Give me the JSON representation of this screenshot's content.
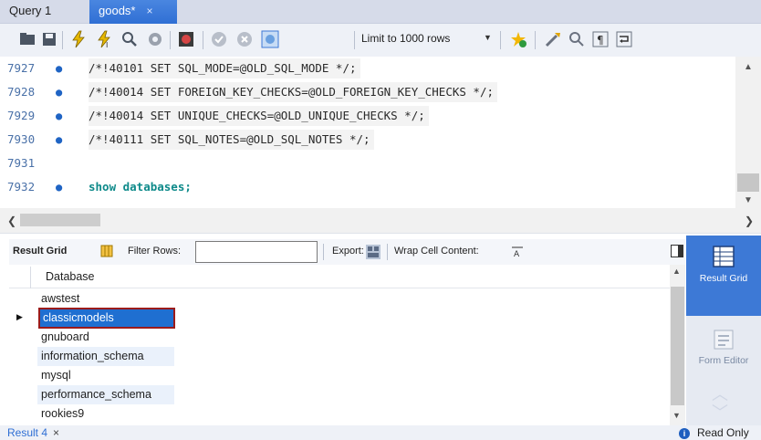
{
  "tabs": [
    {
      "label": "Query 1",
      "active": false
    },
    {
      "label": "goods*",
      "active": true,
      "close": "×"
    }
  ],
  "toolbar": {
    "limit_label": "Limit to 1000 rows"
  },
  "editor": {
    "lines": [
      {
        "number": "7927",
        "marker": "●",
        "code": "/*!40101 SET SQL_MODE=@OLD_SQL_MODE */;"
      },
      {
        "number": "7928",
        "marker": "●",
        "code": "/*!40014 SET FOREIGN_KEY_CHECKS=@OLD_FOREIGN_KEY_CHECKS */;"
      },
      {
        "number": "7929",
        "marker": "●",
        "code": "/*!40014 SET UNIQUE_CHECKS=@OLD_UNIQUE_CHECKS */;"
      },
      {
        "number": "7930",
        "marker": "●",
        "code": "/*!40111 SET SQL_NOTES=@OLD_SQL_NOTES */;"
      },
      {
        "number": "7931",
        "marker": "",
        "code": ""
      },
      {
        "number": "7932",
        "marker": "●",
        "code": "show databases;"
      }
    ]
  },
  "result_toolbar": {
    "result_grid": "Result Grid",
    "filter_rows": "Filter Rows:",
    "filter_value": "",
    "export": "Export:",
    "wrap": "Wrap Cell Content:"
  },
  "grid": {
    "column": "Database",
    "rows": [
      "awstest",
      "classicmodels",
      "gnuboard",
      "information_schema",
      "mysql",
      "performance_schema",
      "rookies9"
    ],
    "selected_index": 1
  },
  "sidebar": {
    "result_grid": "Result Grid",
    "form_editor": "Form Editor"
  },
  "bottom": {
    "result_tab": "Result 4",
    "close": "×",
    "read_only": "Read Only"
  },
  "colors": {
    "accent": "#3d79d6",
    "selection": "#1f6fd1",
    "selection_outline": "#9b1b1b",
    "keyword": "#0e8a8a",
    "line_number": "#4a71a8"
  }
}
